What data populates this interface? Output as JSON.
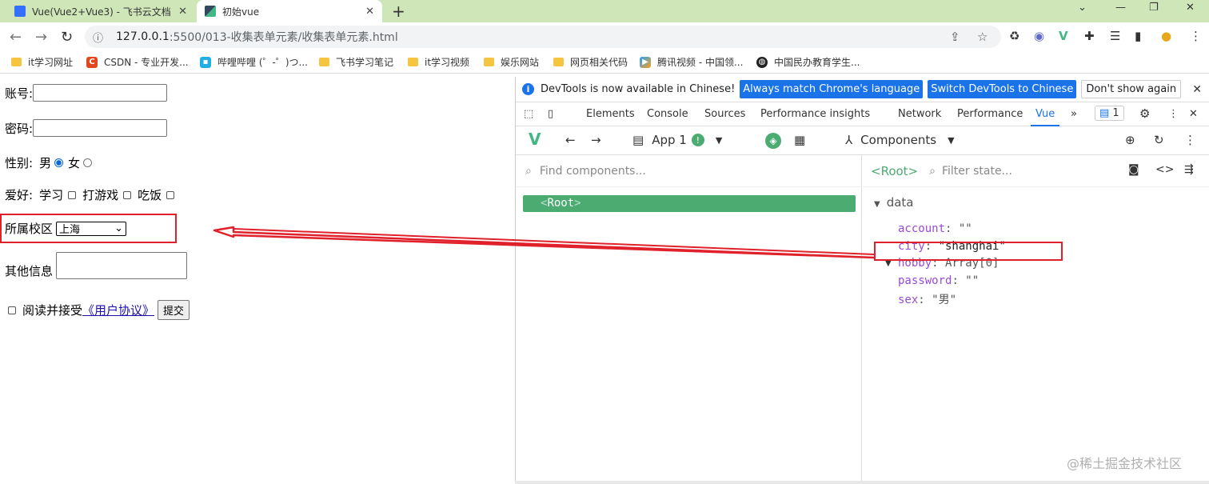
{
  "tabs": [
    {
      "title": "Vue(Vue2+Vue3) - 飞书云文档",
      "favicon_color": "#3370ff"
    },
    {
      "title": "初始vue",
      "favicon_color": "#41b883"
    }
  ],
  "window_controls": [
    "⌄",
    "—",
    "❐",
    "✕"
  ],
  "address": {
    "info_icon": "ⓘ",
    "host": "127.0.0.1",
    "path": ":5500/013-收集表单元素/收集表单元素.html"
  },
  "bookmarks": [
    {
      "label": "it学习网址",
      "type": "folder"
    },
    {
      "label": "CSDN - 专业开发...",
      "type": "site",
      "icon_color": "#e1461e"
    },
    {
      "label": "哔哩哔哩 (゜-゜)つ...",
      "type": "site",
      "icon_color": "#23ade5"
    },
    {
      "label": "飞书学习笔记",
      "type": "folder"
    },
    {
      "label": "it学习视频",
      "type": "folder"
    },
    {
      "label": "娱乐网站",
      "type": "folder"
    },
    {
      "label": "网页相关代码",
      "type": "folder"
    },
    {
      "label": "腾讯视频 - 中国领...",
      "type": "site",
      "icon_color": "#20a0ff"
    },
    {
      "label": "中国民办教育学生...",
      "type": "site",
      "icon_color": "#222222"
    }
  ],
  "form": {
    "account_label": "账号:",
    "password_label": "密码:",
    "sex_label": "性别:",
    "male": "男",
    "female": "女",
    "hobby_label": "爱好:",
    "hobby1": "学习",
    "hobby2": "打游戏",
    "hobby3": "吃饭",
    "campus_label": "所属校区",
    "campus_value": "上海",
    "other_label": "其他信息",
    "agree_text": "阅读并接受",
    "agreement_link": "《用户协议》",
    "submit": "提交"
  },
  "devtools": {
    "info_text": "DevTools is now available in Chinese!",
    "btn_match": "Always match Chrome's language",
    "btn_switch": "Switch DevTools to Chinese",
    "btn_dont": "Don't show again",
    "tabs": [
      "Elements",
      "Console",
      "Sources",
      "Performance insights",
      "Network",
      "Performance",
      "Vue"
    ],
    "issues_count": "1",
    "app_label": "App 1",
    "components_label": "Components",
    "find_placeholder": "Find components...",
    "root_node": "Root",
    "root_header": "<Root>",
    "filter_placeholder": "Filter state...",
    "data_section": "data",
    "props": [
      {
        "key": "account",
        "value": "\"\""
      },
      {
        "key": "city",
        "value": "\"shanghai\""
      },
      {
        "key": "hobby",
        "value": "Array[0]"
      },
      {
        "key": "password",
        "value": "\"\""
      },
      {
        "key": "sex",
        "value": "\"男\""
      }
    ]
  },
  "watermark": "@稀土掘金技术社区",
  "colors": {
    "highlight": "#e0202a",
    "vue_green": "#4bab71",
    "link_blue": "#1a73e8"
  }
}
